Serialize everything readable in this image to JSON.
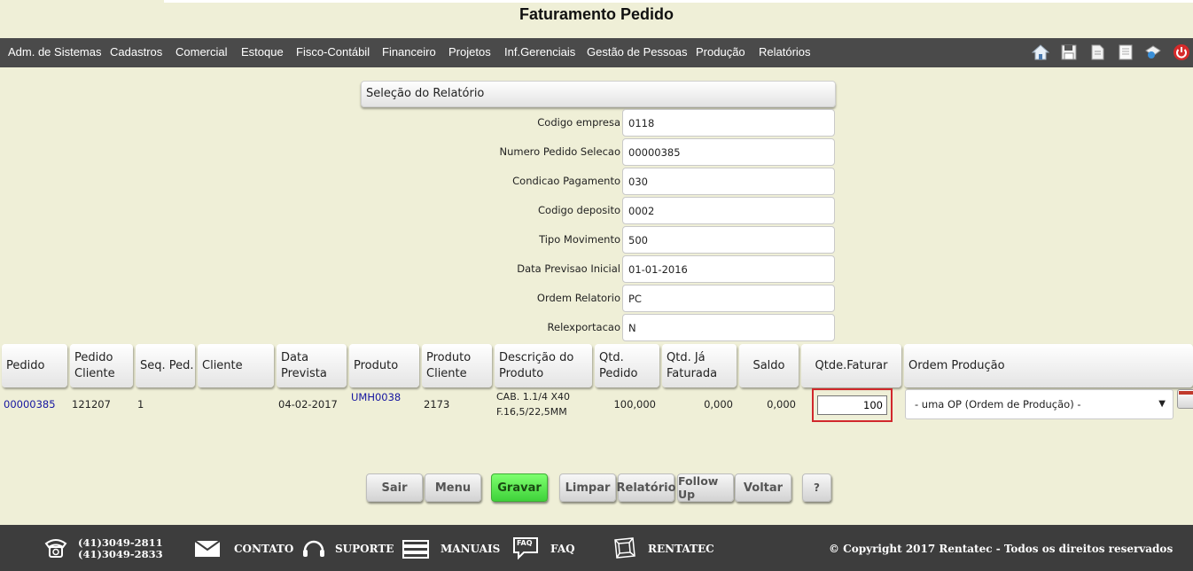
{
  "page": {
    "title": "Faturamento Pedido"
  },
  "menu": {
    "items": [
      "Adm. de Sistemas",
      "Cadastros",
      "Comercial",
      "Estoque",
      "Fisco-Contábil",
      "Financeiro",
      "Projetos",
      "Inf.Gerenciais",
      "Gestão de Pessoas",
      "Produção",
      "Relatórios"
    ],
    "icons": [
      "home-icon",
      "save-disk-icon",
      "document-edit-icon",
      "document-icon",
      "help-book-icon",
      "power-icon"
    ]
  },
  "selection": {
    "header": "Seleção do Relatório",
    "fields": [
      {
        "label": "Codigo empresa",
        "value": "0118"
      },
      {
        "label": "Numero Pedido Selecao",
        "value": "00000385"
      },
      {
        "label": "Condicao Pagamento",
        "value": "030"
      },
      {
        "label": "Codigo deposito",
        "value": "0002"
      },
      {
        "label": "Tipo Movimento",
        "value": "500"
      },
      {
        "label": "Data Previsao Inicial",
        "value": "01-01-2016"
      },
      {
        "label": "Ordem Relatorio",
        "value": "PC"
      },
      {
        "label": "Relexportacao",
        "value": "N"
      }
    ]
  },
  "table": {
    "columns": [
      "Pedido",
      "Pedido Cliente",
      "Seq. Ped.",
      "Cliente",
      "Data Prevista",
      "Produto",
      "Produto Cliente",
      "Descrição do Produto",
      "Qtd. Pedido",
      "Qtd. Já Faturada",
      "Saldo",
      "Qtde.Faturar",
      "Ordem Produção"
    ],
    "rows": [
      {
        "pedido": "00000385",
        "pedido_cliente": "121207",
        "seq_ped": "1",
        "cliente": "",
        "data_prevista": "04-02-2017",
        "produto": "UMH0038",
        "produto_cliente": "2173",
        "descricao_line1": "CAB. 1.1/4 X40",
        "descricao_line2": "F.16,5/22,5MM",
        "qtd_pedido": "100,000",
        "qtd_ja_faturada": "0,000",
        "saldo": "0,000",
        "qtde_faturar": "100",
        "ordem_producao": "- uma OP (Ordem de Produção) -"
      }
    ]
  },
  "buttons": {
    "sair": "Sair",
    "menu": "Menu",
    "gravar": "Gravar",
    "limpar": "Limpar",
    "relatorio": "Relatório",
    "follow_up": "Follow Up",
    "voltar": "Voltar",
    "help": "?"
  },
  "footer": {
    "phone1": "(41)3049-2811",
    "phone2": "(41)3049-2833",
    "contato": "CONTATO",
    "suporte": "SUPORTE",
    "manuais": "MANUAIS",
    "faq": "FAQ",
    "faq_bubble": "FAQ",
    "rentatec": "RENTATEC",
    "copyright": "© Copyright 2017 Rentatec - Todos os direitos reservados"
  },
  "colors": {
    "page_bg": "#efefd7",
    "menubar_bg": "#4a4a4a",
    "footer_bg": "#3d3d3d",
    "link": "#1515a0",
    "highlight_border": "#d1282c",
    "gravar_green": "#5ee852"
  }
}
